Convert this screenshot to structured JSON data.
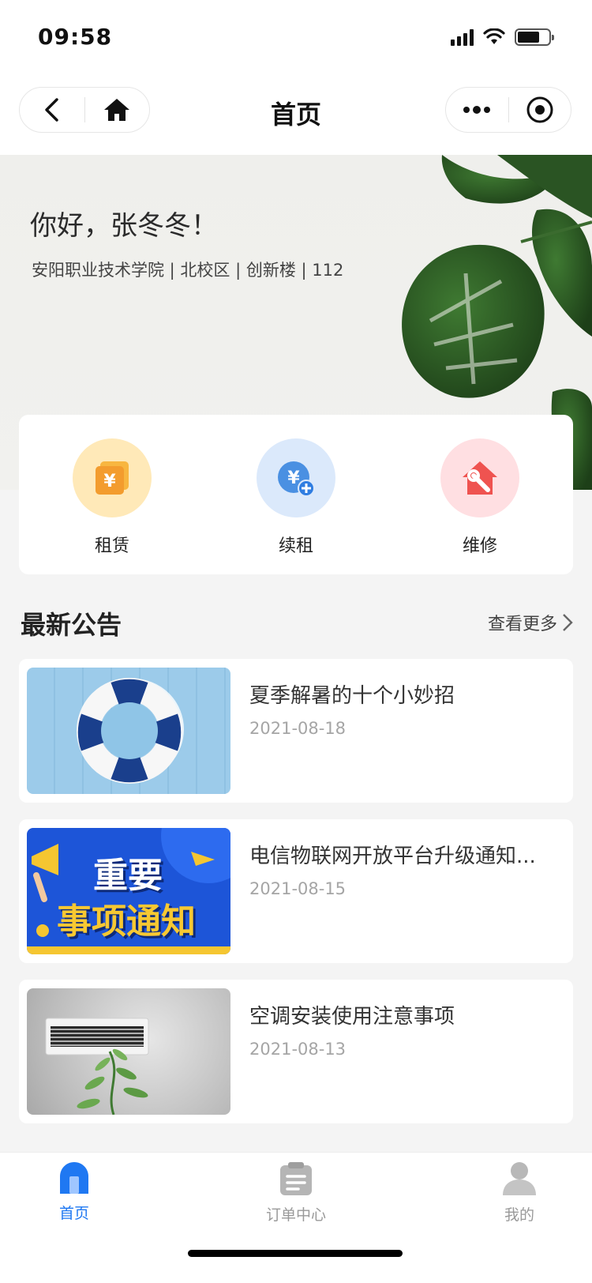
{
  "status_bar": {
    "time": "09:58"
  },
  "nav": {
    "title": "首页"
  },
  "hero": {
    "greeting": "你好，张冬冬！",
    "address": "安阳职业技术学院 | 北校区 | 创新楼 | 112"
  },
  "quick_actions": [
    {
      "label": "租赁",
      "icon": "rent-icon",
      "color": "#ffe9b8"
    },
    {
      "label": "续租",
      "icon": "renew-icon",
      "color": "#dbe9fb"
    },
    {
      "label": "维修",
      "icon": "repair-icon",
      "color": "#ffdfe2"
    }
  ],
  "announcements": {
    "title": "最新公告",
    "more_label": "查看更多",
    "items": [
      {
        "title": "夏季解暑的十个小妙招",
        "date": "2021-08-18"
      },
      {
        "title": "电信物联网开放平台升级通知...",
        "date": "2021-08-15",
        "image_text_1": "重要",
        "image_text_2": "事项通知"
      },
      {
        "title": "空调安装使用注意事项",
        "date": "2021-08-13"
      }
    ]
  },
  "tabbar": {
    "items": [
      {
        "label": "首页",
        "active": true
      },
      {
        "label": "订单中心",
        "active": false
      },
      {
        "label": "我的",
        "active": false
      }
    ]
  },
  "colors": {
    "accent": "#1f78f2",
    "rent": "#f5a623",
    "renew": "#4a90e2",
    "repair": "#ef5350"
  }
}
